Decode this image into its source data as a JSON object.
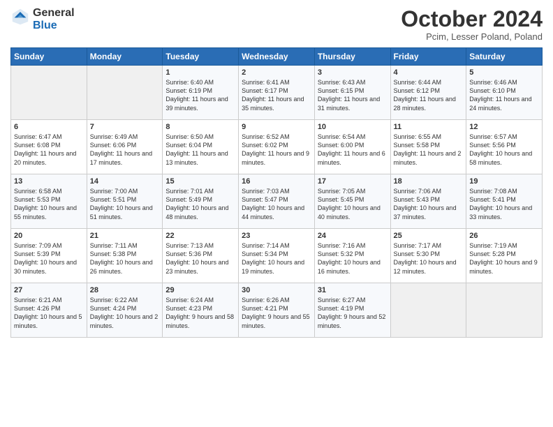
{
  "header": {
    "logo_general": "General",
    "logo_blue": "Blue",
    "month_title": "October 2024",
    "subtitle": "Pcim, Lesser Poland, Poland"
  },
  "days_of_week": [
    "Sunday",
    "Monday",
    "Tuesday",
    "Wednesday",
    "Thursday",
    "Friday",
    "Saturday"
  ],
  "weeks": [
    [
      {
        "day": "",
        "sunrise": "",
        "sunset": "",
        "daylight": "",
        "empty": true
      },
      {
        "day": "",
        "sunrise": "",
        "sunset": "",
        "daylight": "",
        "empty": true
      },
      {
        "day": "1",
        "sunrise": "Sunrise: 6:40 AM",
        "sunset": "Sunset: 6:19 PM",
        "daylight": "Daylight: 11 hours and 39 minutes."
      },
      {
        "day": "2",
        "sunrise": "Sunrise: 6:41 AM",
        "sunset": "Sunset: 6:17 PM",
        "daylight": "Daylight: 11 hours and 35 minutes."
      },
      {
        "day": "3",
        "sunrise": "Sunrise: 6:43 AM",
        "sunset": "Sunset: 6:15 PM",
        "daylight": "Daylight: 11 hours and 31 minutes."
      },
      {
        "day": "4",
        "sunrise": "Sunrise: 6:44 AM",
        "sunset": "Sunset: 6:12 PM",
        "daylight": "Daylight: 11 hours and 28 minutes."
      },
      {
        "day": "5",
        "sunrise": "Sunrise: 6:46 AM",
        "sunset": "Sunset: 6:10 PM",
        "daylight": "Daylight: 11 hours and 24 minutes."
      }
    ],
    [
      {
        "day": "6",
        "sunrise": "Sunrise: 6:47 AM",
        "sunset": "Sunset: 6:08 PM",
        "daylight": "Daylight: 11 hours and 20 minutes."
      },
      {
        "day": "7",
        "sunrise": "Sunrise: 6:49 AM",
        "sunset": "Sunset: 6:06 PM",
        "daylight": "Daylight: 11 hours and 17 minutes."
      },
      {
        "day": "8",
        "sunrise": "Sunrise: 6:50 AM",
        "sunset": "Sunset: 6:04 PM",
        "daylight": "Daylight: 11 hours and 13 minutes."
      },
      {
        "day": "9",
        "sunrise": "Sunrise: 6:52 AM",
        "sunset": "Sunset: 6:02 PM",
        "daylight": "Daylight: 11 hours and 9 minutes."
      },
      {
        "day": "10",
        "sunrise": "Sunrise: 6:54 AM",
        "sunset": "Sunset: 6:00 PM",
        "daylight": "Daylight: 11 hours and 6 minutes."
      },
      {
        "day": "11",
        "sunrise": "Sunrise: 6:55 AM",
        "sunset": "Sunset: 5:58 PM",
        "daylight": "Daylight: 11 hours and 2 minutes."
      },
      {
        "day": "12",
        "sunrise": "Sunrise: 6:57 AM",
        "sunset": "Sunset: 5:56 PM",
        "daylight": "Daylight: 10 hours and 58 minutes."
      }
    ],
    [
      {
        "day": "13",
        "sunrise": "Sunrise: 6:58 AM",
        "sunset": "Sunset: 5:53 PM",
        "daylight": "Daylight: 10 hours and 55 minutes."
      },
      {
        "day": "14",
        "sunrise": "Sunrise: 7:00 AM",
        "sunset": "Sunset: 5:51 PM",
        "daylight": "Daylight: 10 hours and 51 minutes."
      },
      {
        "day": "15",
        "sunrise": "Sunrise: 7:01 AM",
        "sunset": "Sunset: 5:49 PM",
        "daylight": "Daylight: 10 hours and 48 minutes."
      },
      {
        "day": "16",
        "sunrise": "Sunrise: 7:03 AM",
        "sunset": "Sunset: 5:47 PM",
        "daylight": "Daylight: 10 hours and 44 minutes."
      },
      {
        "day": "17",
        "sunrise": "Sunrise: 7:05 AM",
        "sunset": "Sunset: 5:45 PM",
        "daylight": "Daylight: 10 hours and 40 minutes."
      },
      {
        "day": "18",
        "sunrise": "Sunrise: 7:06 AM",
        "sunset": "Sunset: 5:43 PM",
        "daylight": "Daylight: 10 hours and 37 minutes."
      },
      {
        "day": "19",
        "sunrise": "Sunrise: 7:08 AM",
        "sunset": "Sunset: 5:41 PM",
        "daylight": "Daylight: 10 hours and 33 minutes."
      }
    ],
    [
      {
        "day": "20",
        "sunrise": "Sunrise: 7:09 AM",
        "sunset": "Sunset: 5:39 PM",
        "daylight": "Daylight: 10 hours and 30 minutes."
      },
      {
        "day": "21",
        "sunrise": "Sunrise: 7:11 AM",
        "sunset": "Sunset: 5:38 PM",
        "daylight": "Daylight: 10 hours and 26 minutes."
      },
      {
        "day": "22",
        "sunrise": "Sunrise: 7:13 AM",
        "sunset": "Sunset: 5:36 PM",
        "daylight": "Daylight: 10 hours and 23 minutes."
      },
      {
        "day": "23",
        "sunrise": "Sunrise: 7:14 AM",
        "sunset": "Sunset: 5:34 PM",
        "daylight": "Daylight: 10 hours and 19 minutes."
      },
      {
        "day": "24",
        "sunrise": "Sunrise: 7:16 AM",
        "sunset": "Sunset: 5:32 PM",
        "daylight": "Daylight: 10 hours and 16 minutes."
      },
      {
        "day": "25",
        "sunrise": "Sunrise: 7:17 AM",
        "sunset": "Sunset: 5:30 PM",
        "daylight": "Daylight: 10 hours and 12 minutes."
      },
      {
        "day": "26",
        "sunrise": "Sunrise: 7:19 AM",
        "sunset": "Sunset: 5:28 PM",
        "daylight": "Daylight: 10 hours and 9 minutes."
      }
    ],
    [
      {
        "day": "27",
        "sunrise": "Sunrise: 6:21 AM",
        "sunset": "Sunset: 4:26 PM",
        "daylight": "Daylight: 10 hours and 5 minutes."
      },
      {
        "day": "28",
        "sunrise": "Sunrise: 6:22 AM",
        "sunset": "Sunset: 4:24 PM",
        "daylight": "Daylight: 10 hours and 2 minutes."
      },
      {
        "day": "29",
        "sunrise": "Sunrise: 6:24 AM",
        "sunset": "Sunset: 4:23 PM",
        "daylight": "Daylight: 9 hours and 58 minutes."
      },
      {
        "day": "30",
        "sunrise": "Sunrise: 6:26 AM",
        "sunset": "Sunset: 4:21 PM",
        "daylight": "Daylight: 9 hours and 55 minutes."
      },
      {
        "day": "31",
        "sunrise": "Sunrise: 6:27 AM",
        "sunset": "Sunset: 4:19 PM",
        "daylight": "Daylight: 9 hours and 52 minutes."
      },
      {
        "day": "",
        "sunrise": "",
        "sunset": "",
        "daylight": "",
        "empty": true
      },
      {
        "day": "",
        "sunrise": "",
        "sunset": "",
        "daylight": "",
        "empty": true
      }
    ]
  ]
}
